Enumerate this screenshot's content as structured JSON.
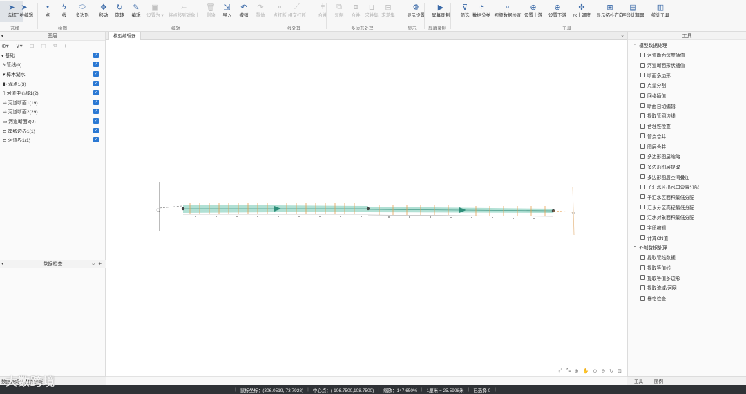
{
  "ribbon": {
    "buttons": [
      {
        "label": "选择",
        "icon": "cursor-arrow-icon"
      },
      {
        "label": "三维编辑",
        "icon": "cursor-3d-icon"
      },
      {
        "label": "点",
        "icon": "point-icon"
      },
      {
        "label": "线",
        "icon": "line-icon"
      },
      {
        "label": "多边形",
        "icon": "polygon-icon"
      },
      {
        "label": "移动",
        "icon": "move-icon"
      },
      {
        "label": "旋转",
        "icon": "rotate-icon"
      },
      {
        "label": "编辑",
        "icon": "pen-icon"
      },
      {
        "label": "设置为 ▾",
        "icon": "set-as-icon"
      },
      {
        "label": "将点移到对象上",
        "icon": "snap-point-icon"
      },
      {
        "label": "删除",
        "icon": "trash-icon"
      },
      {
        "label": "导入",
        "icon": "import-icon"
      },
      {
        "label": "撤销",
        "icon": "undo-icon"
      },
      {
        "label": "重做",
        "icon": "redo-icon"
      },
      {
        "label": "点打断",
        "icon": "point-break-icon"
      },
      {
        "label": "相交打断",
        "icon": "intersect-break-icon"
      },
      {
        "label": "合并",
        "icon": "merge-icon"
      },
      {
        "label": "复制",
        "icon": "copy-icon"
      },
      {
        "label": "合并",
        "icon": "merge-polygon-icon"
      },
      {
        "label": "求并集",
        "icon": "union-icon"
      },
      {
        "label": "求差集",
        "icon": "difference-icon"
      },
      {
        "label": "显示设置",
        "icon": "display-settings-icon"
      },
      {
        "label": "屏幕录制",
        "icon": "screen-record-icon"
      },
      {
        "label": "筛选",
        "icon": "filter-icon"
      },
      {
        "label": "数据分类",
        "icon": "classify-icon"
      },
      {
        "label": "视频数据检查",
        "icon": "video-check-icon"
      },
      {
        "label": "设置上游",
        "icon": "set-upstream-icon"
      },
      {
        "label": "设置下游",
        "icon": "set-downstream-icon"
      },
      {
        "label": "水上调度",
        "icon": "water-dispatch-icon"
      },
      {
        "label": "显示拓扑方向",
        "icon": "topology-direction-icon"
      },
      {
        "label": "字段计算器",
        "icon": "field-calculator-icon"
      },
      {
        "label": "统计工具",
        "icon": "statistics-icon"
      }
    ],
    "groups": [
      {
        "label": "选择"
      },
      {
        "label": "绘图"
      },
      {
        "label": "编辑"
      },
      {
        "label": "线处理"
      },
      {
        "label": "多边形处理"
      },
      {
        "label": "显示"
      },
      {
        "label": "屏幕录制"
      },
      {
        "label": "工具"
      }
    ]
  },
  "left_panel": {
    "title": "图层",
    "layers": [
      {
        "name": "▾ 基础",
        "checked": true
      },
      {
        "name": "ϟ 管线(0)",
        "checked": true
      },
      {
        "name": "▾ 樟木湖水",
        "checked": true
      },
      {
        "name": "▮• 观点1(3)",
        "checked": true
      },
      {
        "name": "▯ 河道中心线1(2)",
        "checked": true
      },
      {
        "name": "⇉ 河道断面1(19)",
        "checked": true
      },
      {
        "name": "⇉ 河道断面2(29)",
        "checked": true
      },
      {
        "name": "▭ 河道断面3(0)",
        "checked": true
      },
      {
        "name": "⊏ 岸线边界1(1)",
        "checked": true
      },
      {
        "name": "⊏ 河道界1(1)",
        "checked": true
      }
    ],
    "lower_title": "数据检查"
  },
  "map": {
    "tab_label": "模型编辑器"
  },
  "right_panel": {
    "title": "工具",
    "categories": [
      {
        "name": "模型数据处理",
        "items": [
          "河道断面深度插值",
          "河道断面形状插值",
          "断面多边形",
          "点量分割",
          "网格插值",
          "断面自动编辑",
          "提取管网边线",
          "合理性检查",
          "管点合并",
          "图层合并",
          "多边形图层缩略",
          "多边形图层提取",
          "多边形图层空间叠加",
          "子汇水区出水口设置分配",
          "子汇水区面积最低分配",
          "汇水分区高程最低分配",
          "汇水对象面积最低分配",
          "字段编辑",
          "计算CN值"
        ]
      },
      {
        "name": "外部数据处理",
        "items": [
          "提取管线数据",
          "提取等值线",
          "提取等值多边形",
          "提取流域/河网",
          "栅格检查"
        ]
      }
    ]
  },
  "bottom_tabs": {
    "left": [
      "数据查询",
      "数据检查"
    ],
    "right": [
      "工具",
      "图例"
    ]
  },
  "status": {
    "mouse": "鼠标坐标：(306.0519,-73.7928)",
    "center": "中心点：(-106.7500,108.7500)",
    "zoom": "缩放：147.650%",
    "scale": "1厘米 = 25.5998米",
    "selected": "已选择 0"
  },
  "watermark": "大数跨境"
}
